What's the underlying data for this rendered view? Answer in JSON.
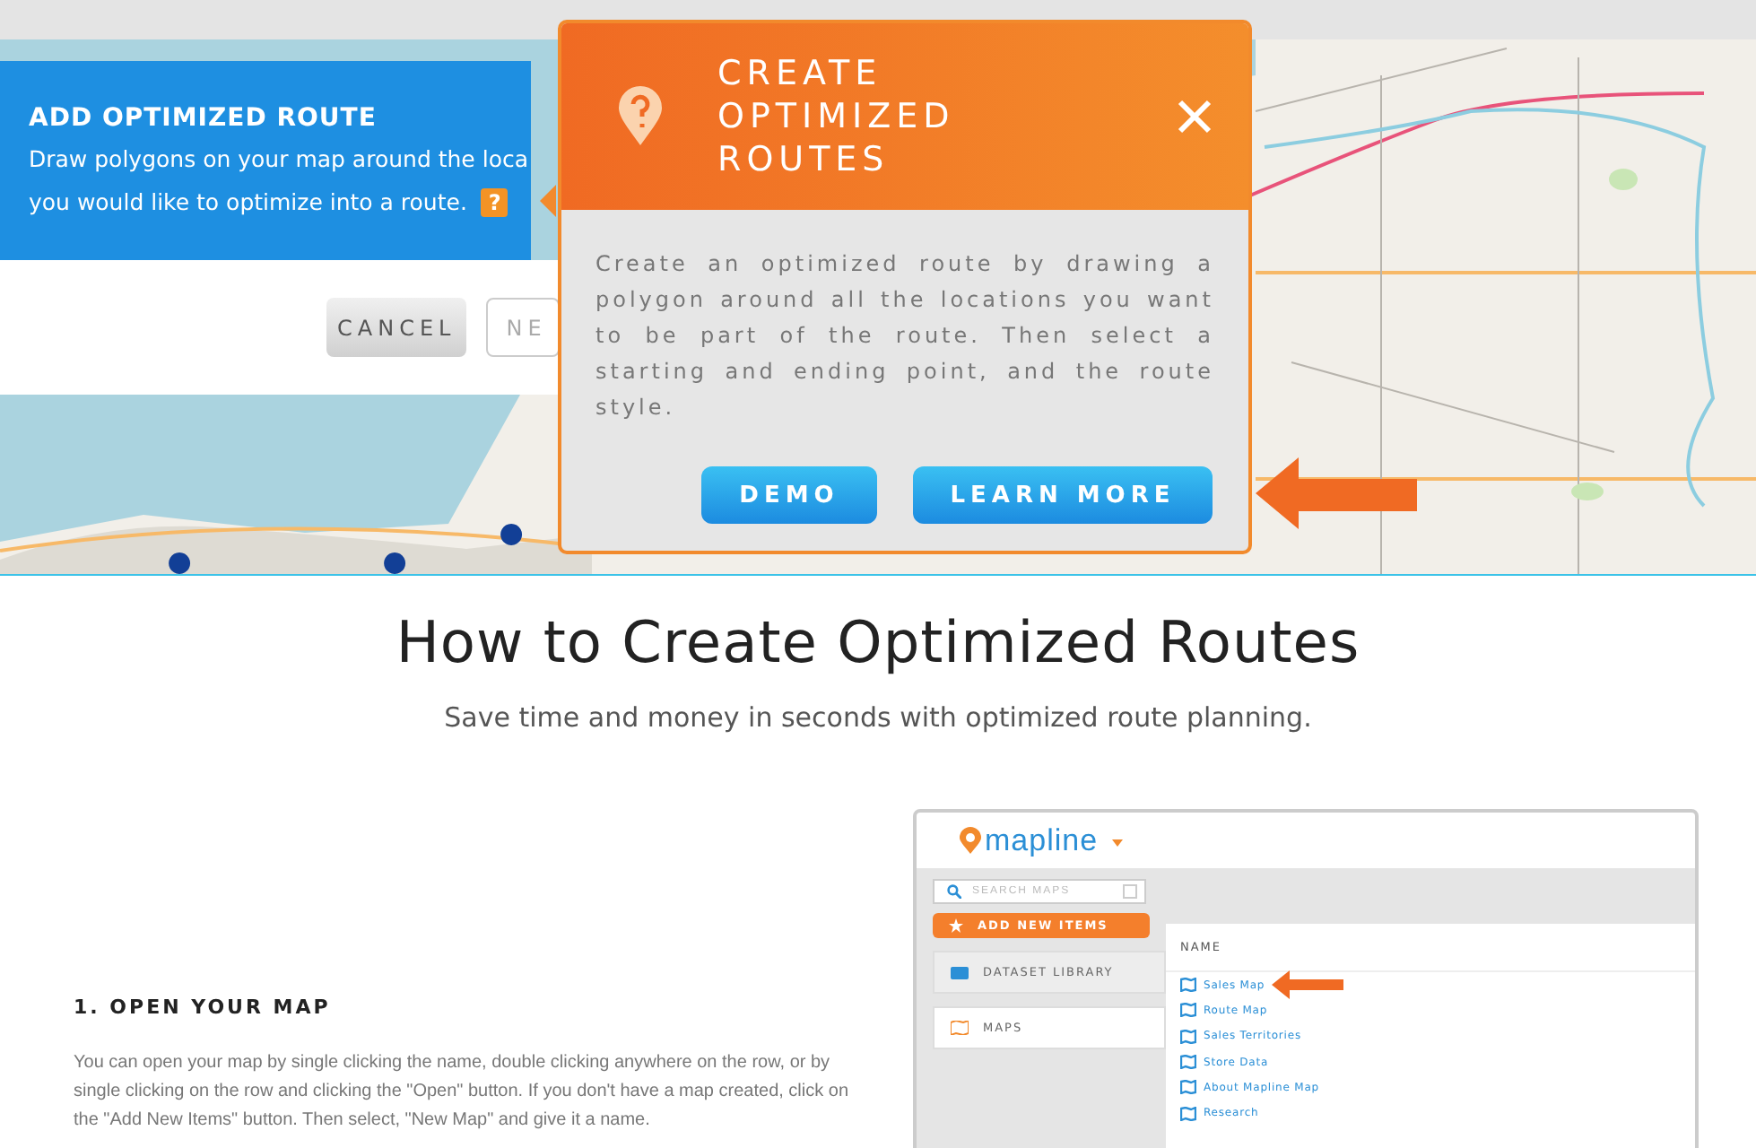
{
  "route_panel": {
    "title": "ADD OPTIMIZED ROUTE",
    "lines": [
      "Draw polygons on your map around the loca",
      "you would like to optimize into a route."
    ],
    "help": "?",
    "buttons": [
      {
        "label": "CANCEL",
        "kind": "secondary"
      },
      {
        "label": "NE",
        "kind": "outline"
      }
    ]
  },
  "popup": {
    "title": "CREATE OPTIMIZED ROUTES",
    "body": "Create an optimized route by drawing a polygon around all the locations you want to be part of the route. Then select a starting and ending point, and the route style.",
    "buttons": [
      "DEMO",
      "LEARN MORE"
    ]
  },
  "page": {
    "heading": "How to Create Optimized Routes",
    "subtitle": "Save time and money in seconds with optimized route planning.",
    "step_title": "1. OPEN YOUR MAP",
    "step_text": "You can open your map by single clicking the name, double clicking anywhere on the row, or by single clicking on the row and clicking the \"Open\" button. If you don't have a map created, click on the \"Add New Items\" button. Then select, \"New Map\" and give it a name."
  },
  "app_screenshot": {
    "logo": "mapline",
    "search": {
      "placeholder": "SEARCH MAPS"
    },
    "add_button": "ADD NEW ITEMS",
    "nav": [
      {
        "label": "DATASET LIBRARY",
        "kind": "dataset",
        "selected": false
      },
      {
        "label": "MAPS",
        "kind": "maps",
        "selected": true
      }
    ],
    "column": "NAME",
    "maps": [
      "Sales Map",
      "Route Map",
      "Sales Territories",
      "Store Data",
      "About Mapline Map",
      "Research"
    ]
  }
}
